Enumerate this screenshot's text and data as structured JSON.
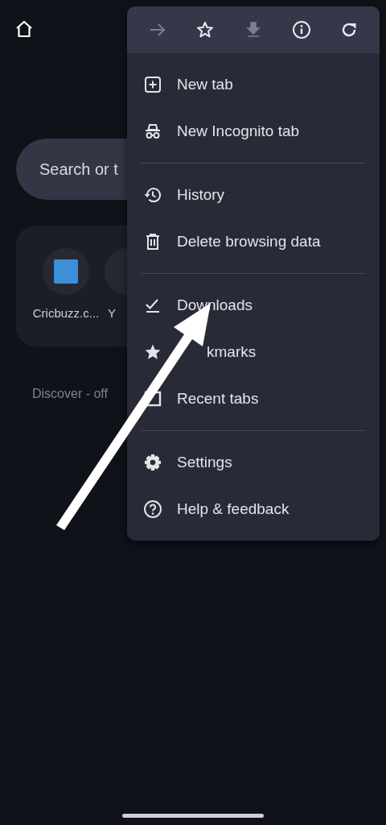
{
  "search": {
    "placeholder": "Search or t"
  },
  "tiles": [
    {
      "label": "Cricbuzz.c..."
    },
    {
      "label": "Y"
    }
  ],
  "discover": "Discover - off",
  "toolbar": [
    {
      "disabled": true
    },
    {
      "disabled": false
    },
    {
      "disabled": true
    },
    {
      "disabled": false
    },
    {
      "disabled": false
    }
  ],
  "menu_sections": [
    [
      {
        "label": "New tab"
      },
      {
        "label": "New Incognito tab"
      }
    ],
    [
      {
        "label": "History"
      },
      {
        "label": "Delete browsing data"
      }
    ],
    [
      {
        "label": "Downloads"
      },
      {
        "label": "kmarks"
      },
      {
        "label": "Recent tabs"
      }
    ],
    [
      {
        "label": "Settings"
      },
      {
        "label": "Help & feedback"
      }
    ]
  ]
}
